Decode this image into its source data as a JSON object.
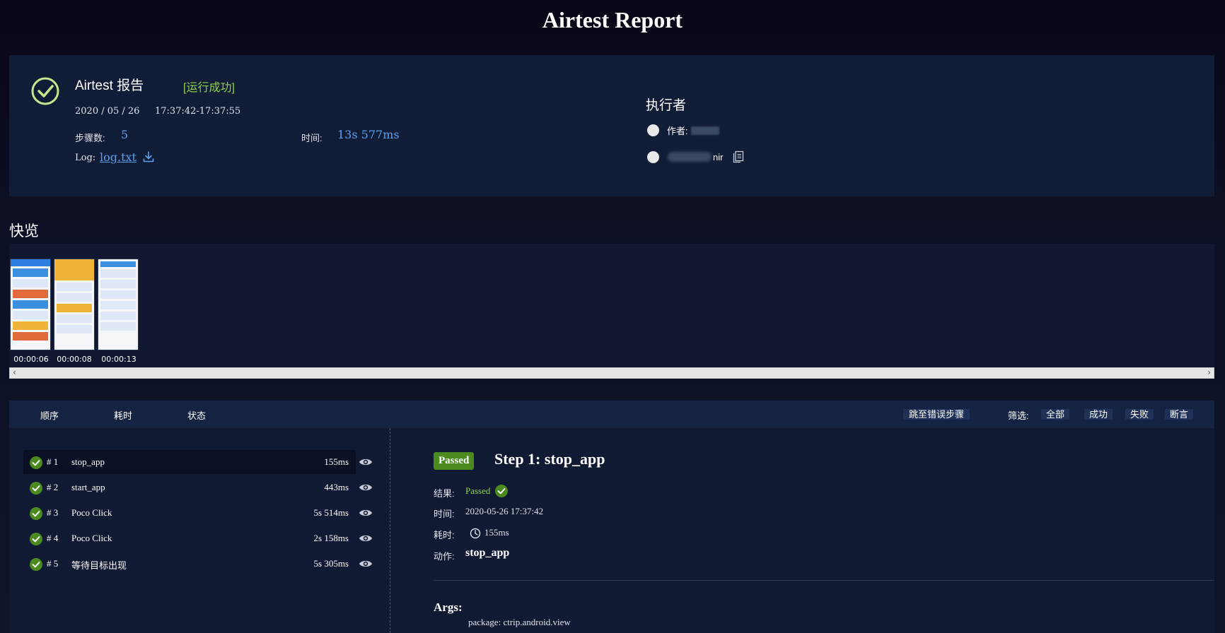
{
  "header": {
    "title": "Airtest Report"
  },
  "summary": {
    "report_name": "Airtest 报告",
    "run_status": "[运行成功]",
    "date": "2020 / 05 / 26",
    "time_range": "17:37:42-17:37:55",
    "steps_label": "步骤数:",
    "steps_count": "5",
    "duration_label": "时间:",
    "duration_value": "13s 577ms",
    "log_label": "Log:",
    "log_file": "log.txt",
    "executor_title": "执行者",
    "author_label": "作者:",
    "script_tail": "nir"
  },
  "quickview": {
    "title": "快览",
    "thumbnails": [
      {
        "time": "00:00:06"
      },
      {
        "time": "00:00:08"
      },
      {
        "time": "00:00:13"
      }
    ]
  },
  "steps_header": {
    "order": "顺序",
    "elapsed": "耗时",
    "status": "状态",
    "jump_to_error": "跳至错误步骤",
    "filter_label": "筛选:",
    "filters": [
      "全部",
      "成功",
      "失败",
      "断言"
    ]
  },
  "steps": [
    {
      "num": "# 1",
      "name": "stop_app",
      "time": "155ms"
    },
    {
      "num": "# 2",
      "name": "start_app",
      "time": "443ms"
    },
    {
      "num": "# 3",
      "name": "Poco Click",
      "time": "5s 514ms"
    },
    {
      "num": "# 4",
      "name": "Poco Click",
      "time": "2s 158ms"
    },
    {
      "num": "# 5",
      "name": "等待目标出现",
      "time": "5s 305ms"
    }
  ],
  "detail": {
    "badge": "Passed",
    "title": "Step 1: stop_app",
    "result_label": "结果:",
    "result_value": "Passed",
    "time_label": "时间:",
    "time_value": "2020-05-26 17:37:42",
    "elapsed_label": "耗时:",
    "elapsed_value": "155ms",
    "action_label": "动作:",
    "action_value": "stop_app",
    "args_title": "Args:",
    "args_line": "package: ctrip.android.view"
  },
  "colors": {
    "success": "#8fd14f",
    "accent": "#5aa0f0",
    "badge": "#4a8a1e"
  }
}
